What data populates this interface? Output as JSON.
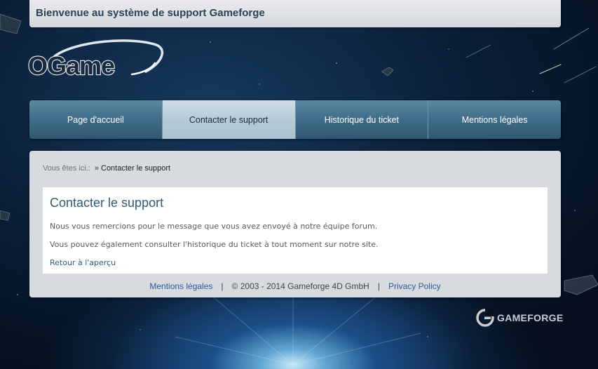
{
  "header": {
    "title": "Bienvenue au système de support Gameforge"
  },
  "logo": {
    "text": "OGame"
  },
  "nav": {
    "items": [
      {
        "label": "Page d'accueil",
        "active": false
      },
      {
        "label": "Contacter le support",
        "active": true
      },
      {
        "label": "Historique du ticket",
        "active": false
      },
      {
        "label": "Mentions légales",
        "active": false
      }
    ]
  },
  "breadcrumb": {
    "prefix": "Vous êtes ici.:",
    "separator": "»",
    "current": "Contacter le support"
  },
  "content": {
    "title": "Contacter le support",
    "paragraph1": "Nous vous remercions pour le message que vous avez envoyé à notre équipe forum.",
    "paragraph2": "Vous pouvez également consulter l'historique du ticket à tout moment sur notre site.",
    "back_link": "Retour à l'aperçu"
  },
  "footer": {
    "legal_link": "Mentions légales",
    "separator": "|",
    "copyright": "© 2003 - 2014 Gameforge 4D GmbH",
    "privacy_link": "Privacy Policy"
  },
  "brand": {
    "name": "GAMEFORGE",
    "icon": "gameforge-logo-icon"
  },
  "colors": {
    "nav_bg": "#3f6c88",
    "nav_active_bg": "#b6cbd7",
    "title_color": "#2e5a7a",
    "link_color": "#2e5a9a",
    "panel_bg": "#d7dbe0"
  }
}
